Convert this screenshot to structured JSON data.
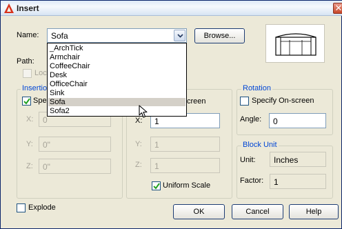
{
  "window": {
    "title": "Insert",
    "close_glyph": "✕"
  },
  "name": {
    "label": "Name:",
    "value": "Sofa",
    "browse_label": "Browse..."
  },
  "path": {
    "label": "Path:"
  },
  "locate_label": "Loca",
  "dropdown": {
    "items": [
      "_ArchTick",
      "Armchair",
      "CoffeeChair",
      "Desk",
      "OfficeChair",
      "Sink",
      "Sofa",
      "Sofa2"
    ],
    "highlighted_index": 6
  },
  "insertion": {
    "title": "Insertio",
    "specify_label": "Spec",
    "specify_checked": true,
    "x_label": "X:",
    "x_value": "0",
    "y_label": "Y:",
    "y_value": "0\"",
    "z_label": "Z:",
    "z_value": "0\""
  },
  "scale": {
    "specify_fragment": "creen",
    "x_label": "X:",
    "x_value": "1",
    "y_label": "Y:",
    "y_value": "1",
    "z_label": "Z:",
    "z_value": "1",
    "uniform_label": "Uniform Scale",
    "uniform_checked": true
  },
  "rotation": {
    "title": "Rotation",
    "specify_label": "Specify On-screen",
    "specify_checked": false,
    "angle_label": "Angle:",
    "angle_value": "0"
  },
  "block_unit": {
    "title": "Block Unit",
    "unit_label": "Unit:",
    "unit_value": "Inches",
    "factor_label": "Factor:",
    "factor_value": "1"
  },
  "explode": {
    "label": "Explode",
    "checked": false
  },
  "buttons": {
    "ok": "OK",
    "cancel": "Cancel",
    "help": "Help"
  },
  "colors": {
    "accent": "#0046d5",
    "title_icon": "#d7321c"
  }
}
